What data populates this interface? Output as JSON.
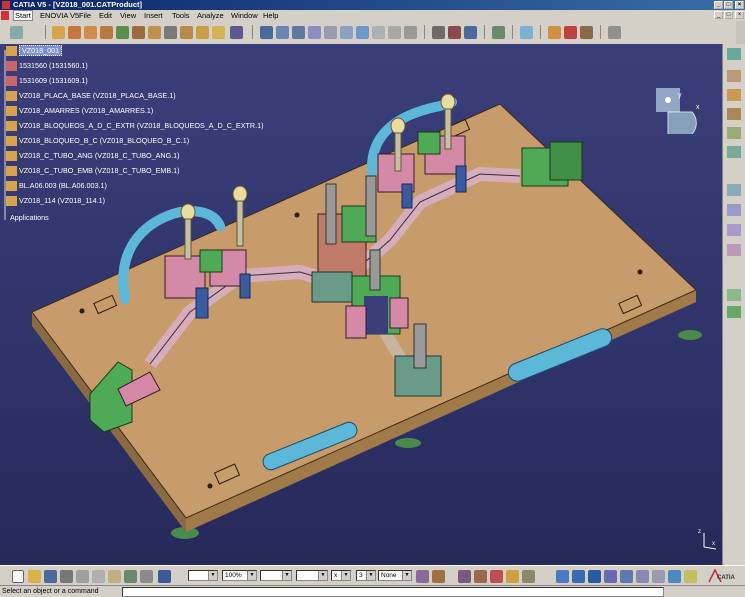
{
  "window": {
    "title": "CATIA V5 - [VZ018_001.CATProduct]"
  },
  "menu": {
    "items": [
      "Start",
      "ENOVIA V5",
      "File",
      "Edit",
      "View",
      "Insert",
      "Tools",
      "Analyze",
      "Window",
      "Help"
    ]
  },
  "tree": {
    "root": "VZ018_001",
    "items": [
      "1531560 (1531560.1)",
      "1531609 (1531609.1)",
      "VZ018_PLACA_BASE (VZ018_PLACA_BASE.1)",
      "VZ018_AMARRES (VZ018_AMARRES.1)",
      "VZ018_BLOQUEOS_A_D_C_EXTR (VZ018_BLOQUEOS_A_D_C_EXTR.1)",
      "VZ018_BLOQUEO_B_C (VZ018_BLOQUEO_B_C.1)",
      "VZ018_C_TUBO_ANG (VZ018_C_TUBO_ANG.1)",
      "VZ018_C_TUBO_EMB (VZ018_C_TUBO_EMB.1)",
      "BL.A06.003 (BL.A06.003.1)",
      "VZ018_114 (VZ018_114.1)"
    ],
    "applications": "Applications"
  },
  "compass": {
    "x_label": "x",
    "y_label": "y"
  },
  "axis_triad": {
    "x_label": "x",
    "z_label": "z"
  },
  "bottom_toolbar": {
    "line_style_1": "",
    "zoom_value": "100%",
    "line_style_2": "",
    "line_style_3": "",
    "marker": "x",
    "layer_value": "3",
    "layer_filter": "None",
    "catia_logo": "CATIA"
  },
  "status": {
    "prompt": "Select an object or a command"
  },
  "colors": {
    "background_top": "#3a3f7a",
    "background_bottom": "#25295a",
    "base_plate": "#c79b6a",
    "fixture_pink": "#d48aa6",
    "fixture_green": "#4faa55",
    "tube_blue": "#5bb8d8",
    "clamp_handle": "#e8dca0"
  }
}
